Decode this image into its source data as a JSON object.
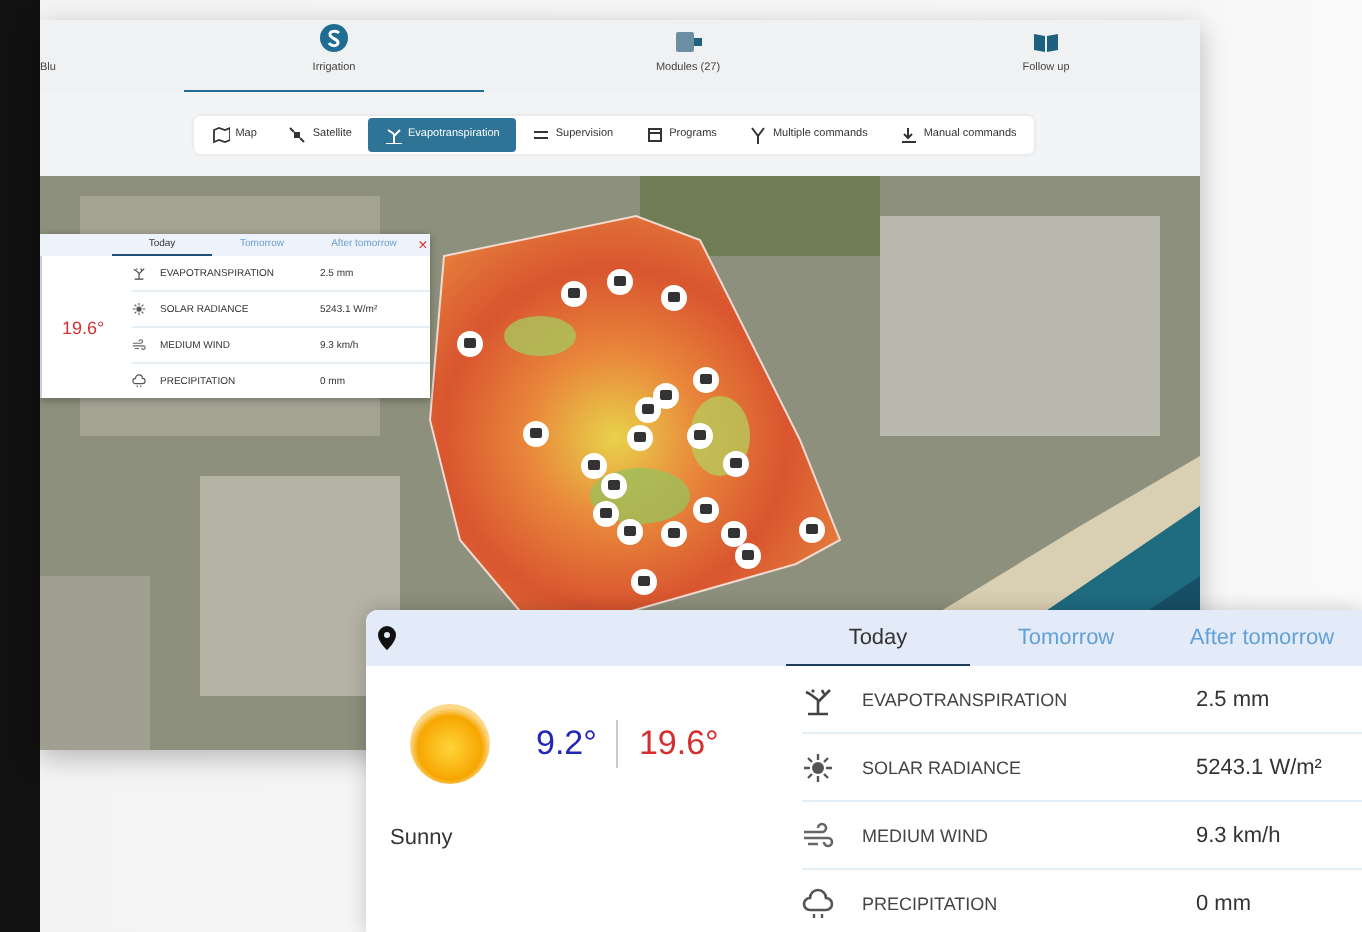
{
  "app_window": {
    "nav_tabs": [
      {
        "label": "Blu",
        "selected": false
      },
      {
        "label": "Irrigation",
        "selected": true
      },
      {
        "label": "Modules (27)",
        "selected": false
      },
      {
        "label": "Follow up",
        "selected": false
      }
    ],
    "view_buttons": [
      {
        "label": "Map",
        "selected": false
      },
      {
        "label": "Satellite",
        "selected": false
      },
      {
        "label": "Evapotranspiration",
        "selected": true
      },
      {
        "label": "Supervision",
        "selected": false
      },
      {
        "label": "Programs",
        "selected": false
      },
      {
        "label": "Multiple commands",
        "selected": false
      },
      {
        "label": "Manual commands",
        "selected": false
      }
    ],
    "weather_popup": {
      "tabs": [
        {
          "label": "Today",
          "selected": true
        },
        {
          "label": "Tomorrow",
          "selected": false
        },
        {
          "label": "After tomorrow",
          "selected": false
        }
      ],
      "close": "×",
      "temperature_max": "19.6°",
      "metrics": [
        {
          "label": "EVAPOTRANSPIRATION",
          "value": "2.5 mm"
        },
        {
          "label": "SOLAR RADIANCE",
          "value": "5243.1 W/m²"
        },
        {
          "label": "MEDIUM WIND",
          "value": "9.3 km/h"
        },
        {
          "label": "PRECIPITATION",
          "value": "0 mm"
        }
      ]
    }
  },
  "weather_card": {
    "tabs": [
      {
        "label": "Today",
        "selected": true
      },
      {
        "label": "Tomorrow",
        "selected": false
      },
      {
        "label": "After tomorrow",
        "selected": false
      }
    ],
    "temperature_min": "9.2°",
    "temperature_max": "19.6°",
    "condition": "Sunny",
    "metrics": [
      {
        "label": "EVAPOTRANSPIRATION",
        "value": "2.5 mm"
      },
      {
        "label": "SOLAR RADIANCE",
        "value": "5243.1 W/m²"
      },
      {
        "label": "MEDIUM WIND",
        "value": "9.3 km/h"
      },
      {
        "label": "PRECIPITATION",
        "value": "0 mm"
      }
    ]
  }
}
